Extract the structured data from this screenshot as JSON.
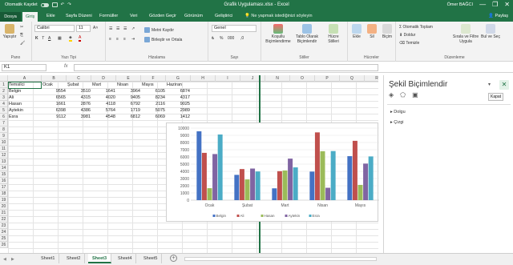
{
  "window": {
    "autosave_label": "Otomatik Kaydet",
    "title": "Grafik Uygulaması.xlsx  -  Excel",
    "user": "Ömer BAĞCI",
    "controls": [
      "—",
      "❐",
      "✕"
    ]
  },
  "tabs": [
    "Dosya",
    "Giriş",
    "Ekle",
    "Sayfa Düzeni",
    "Formüller",
    "Veri",
    "Gözden Geçir",
    "Görünüm",
    "Geliştirici"
  ],
  "active_tab": "Giriş",
  "tell_me": "Ne yapmak istediğinizi söyleyin",
  "share": "Paylaş",
  "ribbon": {
    "clipboard": {
      "paste": "Yapıştır",
      "group": "Pano"
    },
    "font": {
      "name": "Calibri",
      "size": "11",
      "bold": "K",
      "italic": "T",
      "underline": "A",
      "group": "Yazı Tipi"
    },
    "alignment": {
      "wrap": "Metni Kaydır",
      "merge": "Birleştir ve Ortala",
      "group": "Hizalama"
    },
    "number": {
      "format": "Genel",
      "group": "Sayı"
    },
    "styles": {
      "conditional": "Koşullu Biçimlendirme",
      "table": "Tablo Olarak Biçimlendir",
      "cell_styles": "Hücre Stilleri",
      "group": "Stiller"
    },
    "cells": {
      "insert": "Ekle",
      "delete": "Sil",
      "format": "Biçim",
      "group": "Hücreler"
    },
    "editing": {
      "autosum": "Otomatik Toplam",
      "fill": "Doldur",
      "clear": "Temizle",
      "sort": "Sırala ve Filtre Uygula",
      "find": "Bul ve Seç",
      "group": "Düzenleme"
    }
  },
  "formula_bar": {
    "name_box": "K1",
    "fx": "fx",
    "value": ""
  },
  "columns": [
    "A",
    "B",
    "C",
    "D",
    "E",
    "F",
    "G",
    "H",
    "I",
    "J",
    "N",
    "O",
    "P",
    "Q",
    "R"
  ],
  "rows": [
    "1",
    "2",
    "3",
    "4",
    "5",
    "6",
    "7",
    "8",
    "9",
    "10",
    "11",
    "12",
    "13",
    "14",
    "15",
    "16",
    "17",
    "18",
    "19",
    "20",
    "21",
    "22",
    "23",
    "24",
    "25",
    "26"
  ],
  "table": {
    "headers": [
      "Temsilci",
      "Ocak",
      "Şubat",
      "Mart",
      "Nisan",
      "Mayıs",
      "Haziran"
    ],
    "rows": [
      [
        "Belgin",
        "9554",
        "3510",
        "1641",
        "3964",
        "6105",
        "6874"
      ],
      [
        "Ali",
        "6565",
        "4315",
        "4020",
        "9405",
        "8234",
        "4317"
      ],
      [
        "Hasan",
        "1661",
        "2876",
        "4118",
        "6792",
        "2116",
        "9025"
      ],
      [
        "Aytekin",
        "6398",
        "4386",
        "5764",
        "1719",
        "5075",
        "2989"
      ],
      [
        "Esra",
        "9112",
        "3981",
        "4548",
        "6812",
        "6069",
        "1412"
      ]
    ]
  },
  "chart_data": {
    "type": "bar",
    "categories": [
      "Ocak",
      "Şubat",
      "Mart",
      "Nisan",
      "Mayıs"
    ],
    "series": [
      {
        "name": "Belgin",
        "values": [
          9554,
          3510,
          1641,
          3964,
          6105
        ],
        "color": "#4472c4"
      },
      {
        "name": "Ali",
        "values": [
          6565,
          4315,
          4020,
          9405,
          8234
        ],
        "color": "#c0504d"
      },
      {
        "name": "Hasan",
        "values": [
          1661,
          2876,
          4118,
          6792,
          2116
        ],
        "color": "#9bbb59"
      },
      {
        "name": "Aytekin",
        "values": [
          6398,
          4386,
          5764,
          1719,
          5075
        ],
        "color": "#8064a2"
      },
      {
        "name": "Esra",
        "values": [
          9112,
          3981,
          4548,
          6812,
          6069
        ],
        "color": "#4bacc6"
      }
    ],
    "ylim": [
      0,
      10000
    ],
    "yticks": [
      "0",
      "1000",
      "2000",
      "3000",
      "4000",
      "5000",
      "6000",
      "7000",
      "8000",
      "9000",
      "10000"
    ],
    "legend": "bottom",
    "grid": true,
    "title": ""
  },
  "sheets": [
    "Sheet1",
    "Sheet2",
    "Sheet3",
    "Sheet4",
    "Sheet5"
  ],
  "active_sheet": "Sheet3",
  "format_pane": {
    "title": "Şekil Biçimlendir",
    "close_label": "Kapat",
    "sections": [
      "Dolgu",
      "Çizgi"
    ]
  },
  "colors": {
    "accent": "#217346"
  }
}
